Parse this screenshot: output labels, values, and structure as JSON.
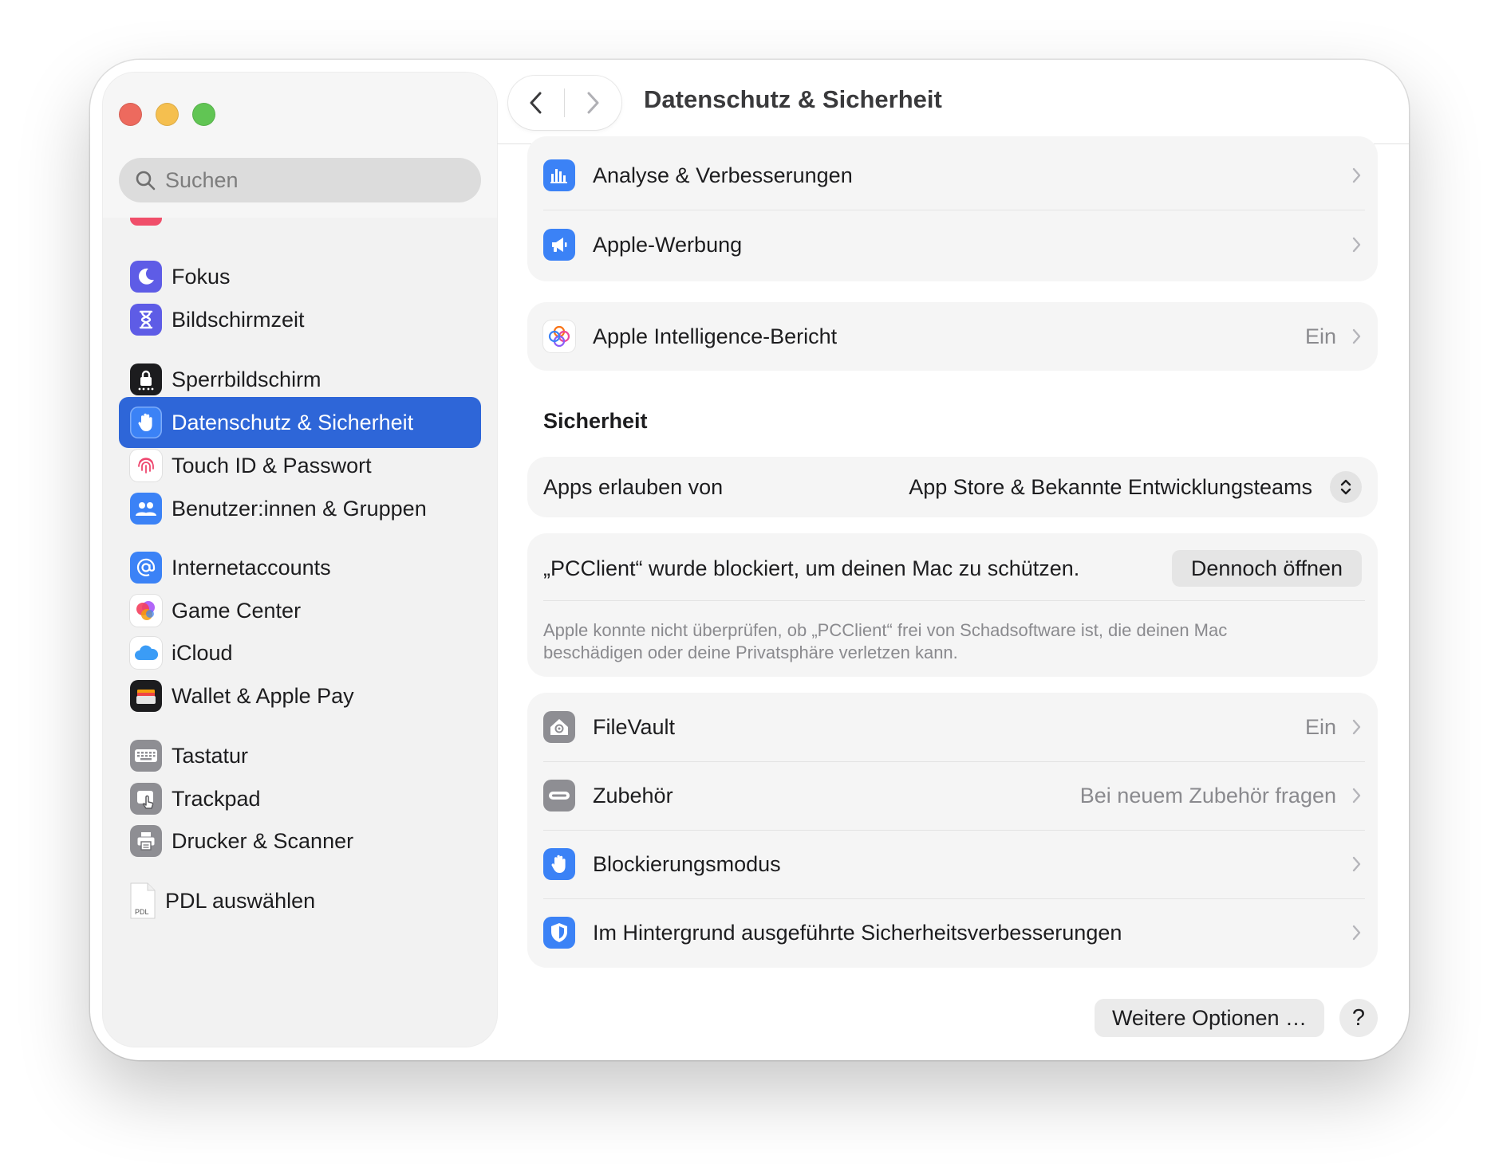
{
  "window": {
    "title": "Datenschutz & Sicherheit"
  },
  "sidebar": {
    "search_placeholder": "Suchen",
    "items": [
      {
        "label": "Fokus",
        "icon": "moon-icon"
      },
      {
        "label": "Bildschirmzeit",
        "icon": "hourglass-icon"
      },
      {
        "label": "Sperrbildschirm",
        "icon": "lock-icon"
      },
      {
        "label": "Datenschutz & Sicherheit",
        "icon": "hand-icon",
        "active": true
      },
      {
        "label": "Touch ID & Passwort",
        "icon": "fingerprint-icon"
      },
      {
        "label": "Benutzer:innen & Gruppen",
        "icon": "users-icon"
      },
      {
        "label": "Internetaccounts",
        "icon": "at-icon"
      },
      {
        "label": "Game Center",
        "icon": "game-center-icon"
      },
      {
        "label": "iCloud",
        "icon": "cloud-icon"
      },
      {
        "label": "Wallet & Apple Pay",
        "icon": "wallet-icon"
      },
      {
        "label": "Tastatur",
        "icon": "keyboard-icon"
      },
      {
        "label": "Trackpad",
        "icon": "trackpad-icon"
      },
      {
        "label": "Drucker & Scanner",
        "icon": "printer-icon"
      },
      {
        "label": "PDL auswählen",
        "icon": "document-icon",
        "icon_text": "PDL"
      }
    ]
  },
  "privacy": {
    "analytics_label": "Analyse & Verbesserungen",
    "ads_label": "Apple-Werbung",
    "intelligence_label": "Apple Intelligence-Bericht",
    "intelligence_value": "Ein"
  },
  "security": {
    "section_title": "Sicherheit",
    "apps_label": "Apps erlauben von",
    "apps_value": "App Store & Bekannte Entwicklungsteams",
    "blocked_text": "„PCClient“ wurde blockiert, um deinen Mac zu schützen.",
    "open_anyway": "Dennoch öffnen",
    "blocked_note": "Apple konnte nicht überprüfen, ob „PCClient“ frei von Schadsoftware ist, die deinen Mac beschädigen oder deine Privatsphäre verletzen kann.",
    "filevault_label": "FileVault",
    "filevault_value": "Ein",
    "accessories_label": "Zubehör",
    "accessories_value": "Bei neuem Zubehör fragen",
    "lockdown_label": "Blockierungsmodus",
    "background_label": "Im Hintergrund ausgeführte Sicherheitsverbesserungen"
  },
  "footer": {
    "more_options": "Weitere Optionen …",
    "help": "?"
  },
  "colors": {
    "accent": "#2e66d8",
    "close": "#ed6a5e",
    "minimize": "#f5bf4f",
    "zoom": "#61c554"
  }
}
